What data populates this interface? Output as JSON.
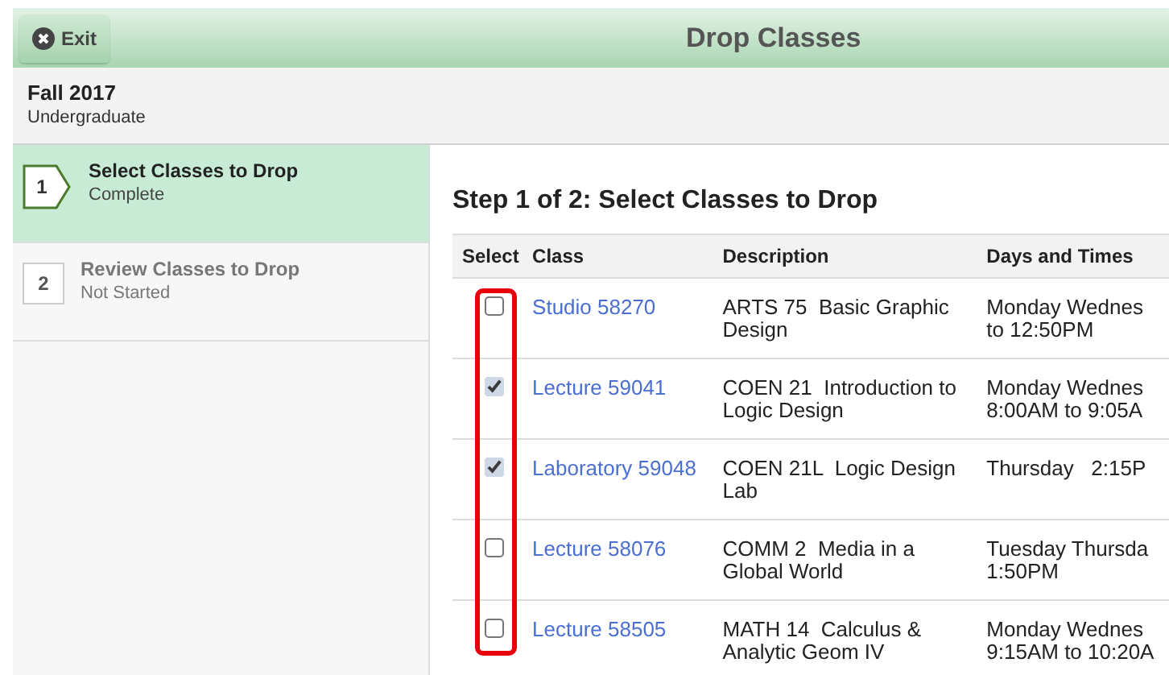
{
  "header": {
    "exit_label": "Exit",
    "title": "Drop Classes"
  },
  "term": {
    "name": "Fall 2017",
    "career": "Undergraduate"
  },
  "steps": [
    {
      "number": "1",
      "title": "Select Classes to Drop",
      "status": "Complete",
      "selected": true
    },
    {
      "number": "2",
      "title": "Review Classes to Drop",
      "status": "Not Started",
      "selected": false
    }
  ],
  "heading": "Step 1 of 2: Select Classes to Drop",
  "table": {
    "columns": [
      "Select",
      "Class",
      "Description",
      "Days and Times"
    ],
    "rows": [
      {
        "checked": false,
        "class": "Studio 58270",
        "description": "ARTS 75  Basic Graphic Design",
        "days": [
          "Monday Wednes",
          "to 12:50PM"
        ]
      },
      {
        "checked": true,
        "class": "Lecture 59041",
        "description": "COEN 21  Introduction to Logic Design",
        "days": [
          "Monday Wednes",
          "8:00AM to 9:05A"
        ]
      },
      {
        "checked": true,
        "class": "Laboratory 59048",
        "description": "COEN 21L  Logic Design Lab",
        "days": [
          "Thursday   2:15P"
        ]
      },
      {
        "checked": false,
        "class": "Lecture 58076",
        "description": "COMM 2  Media in a Global World",
        "days": [
          "Tuesday Thursda",
          "1:50PM"
        ]
      },
      {
        "checked": false,
        "class": "Lecture 58505",
        "description": "MATH 14  Calculus & Analytic Geom IV",
        "days": [
          "Monday Wednes",
          "9:15AM to 10:20A"
        ]
      }
    ]
  }
}
